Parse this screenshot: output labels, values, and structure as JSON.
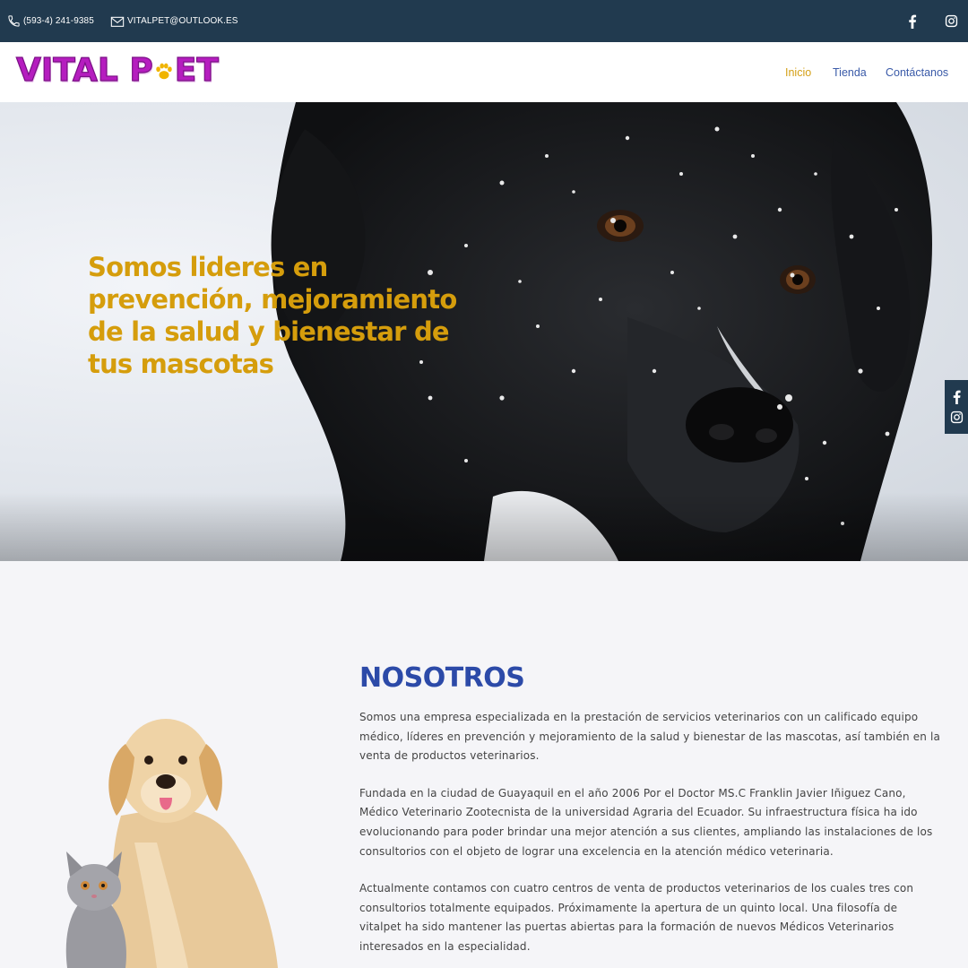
{
  "topbar": {
    "phone": "(593-4) 241-9385",
    "email": "VITALPET@OUTLOOK.ES",
    "phone_icon": "phone-icon",
    "email_icon": "envelope-icon",
    "social": [
      "facebook-icon",
      "instagram-icon"
    ]
  },
  "header": {
    "logo_left": "VITAL P",
    "logo_right": "ET",
    "nav": [
      {
        "label": "Inicio",
        "active": true
      },
      {
        "label": "Tienda"
      },
      {
        "label": "Contáctanos"
      }
    ]
  },
  "hero": {
    "title": "Somos lideres en prevención, mejoramiento de la salud y bienestar de tus mascotas"
  },
  "about": {
    "title": "NOSOTROS",
    "paragraphs": [
      "Somos una empresa especializada en la prestación de servicios veterinarios con un calificado equipo médico, líderes en prevención y mejoramiento de la salud y bienestar de las mascotas, así también en la venta de productos veterinarios.",
      "Fundada en la ciudad de Guayaquil en el año 2006 Por el Doctor MS.C Franklin Javier Iñiguez Cano, Médico Veterinario Zootecnista de la universidad Agraria del Ecuador. Su infraestructura física ha ido evolucionando para poder brindar una mejor atención a sus clientes, ampliando las instalaciones de los consultorios con el objeto de lograr una excelencia en la atención médico veterinaria.",
      "Actualmente contamos con cuatro centros de venta de productos veterinarios de los cuales tres con consultorios totalmente equipados. Próximamente la apertura de un quinto local. Una filosofía de vitalpet ha sido mantener las puertas abiertas para la formación de nuevos Médicos Veterinarios interesados en la especialidad."
    ]
  },
  "colors": {
    "topbar": "#213a4f",
    "brand": "#b51dbf",
    "accent": "#d59d0c",
    "link": "#3a5aa8",
    "heading": "#2c4aa8"
  }
}
